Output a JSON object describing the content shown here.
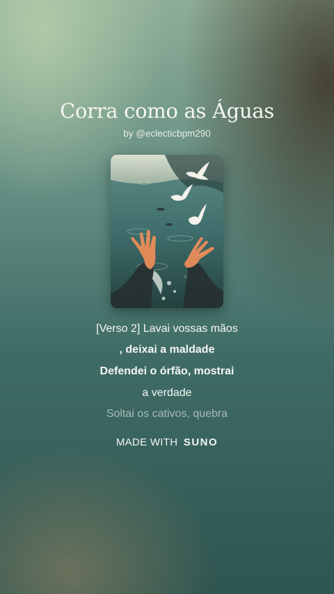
{
  "song": {
    "title": "Corra como as Águas",
    "byline": "by @eclecticbpm290"
  },
  "lyrics": [
    {
      "text": "[Verso 2] Lavai vossas mãos",
      "style": "normal"
    },
    {
      "text": ", deixai a maldade",
      "style": "strong"
    },
    {
      "text": "Defendei o órfão, mostrai",
      "style": "strong"
    },
    {
      "text": "a verdade",
      "style": "normal"
    },
    {
      "text": "Soltai os cativos, quebra",
      "style": "fade"
    }
  ],
  "branding": {
    "made_with": "MADE WITH",
    "logo": "SUNO"
  },
  "cover_art": {
    "icons": [
      "dove-icon",
      "reaching-hands-icon"
    ],
    "colors": {
      "water": "#3d6a6a",
      "sky": "#cfd8c4",
      "doves": "#f3f1ea"
    }
  }
}
